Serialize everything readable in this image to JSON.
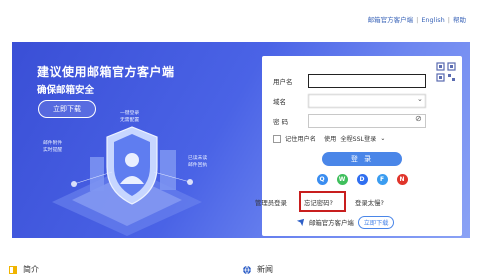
{
  "topnav": {
    "client": "邮箱官方客户端",
    "english": "English",
    "help": "帮助"
  },
  "banner": {
    "title": "建议使用邮箱官方客户端",
    "subtitle": "确保邮箱安全",
    "download_label": "立即下载",
    "features": [
      "一键登录\n无需配置",
      "邮件附件\n实时提醒",
      "已读未读\n邮件回执"
    ]
  },
  "login": {
    "username_label": "用户名",
    "domain_label": "域名",
    "domain_value": "",
    "password_label": "密 码",
    "remember_label": "记住用户名",
    "use_label": "使用",
    "ssl_option": "全程SSL登录",
    "login_label": "登 录",
    "social_icons": [
      "qq-icon",
      "wechat-icon",
      "dingtalk-icon",
      "feishu-icon",
      "netease-icon"
    ]
  },
  "links": {
    "admin": "管理员登录",
    "forgot": "忘记密码?",
    "login_trouble": "登录太慢?",
    "client": "邮箱官方客户端",
    "download": "立即下载"
  },
  "sections": {
    "intro": "简介",
    "news": "新闻"
  },
  "colors": {
    "banner": "#4a63e6",
    "button": "#4a86e8",
    "highlight": "#c81e1e"
  }
}
